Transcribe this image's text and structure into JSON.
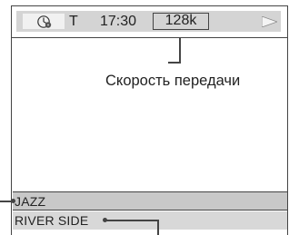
{
  "status_bar": {
    "clock_icon": "clock-disc-icon",
    "mode": "T",
    "time": "17:30",
    "bitrate": "128k",
    "play_icon": "play-icon"
  },
  "callout": {
    "caption": "Скорость передачи"
  },
  "info_rows": {
    "genre": "JAZZ",
    "album": "RIVER SIDE"
  }
}
